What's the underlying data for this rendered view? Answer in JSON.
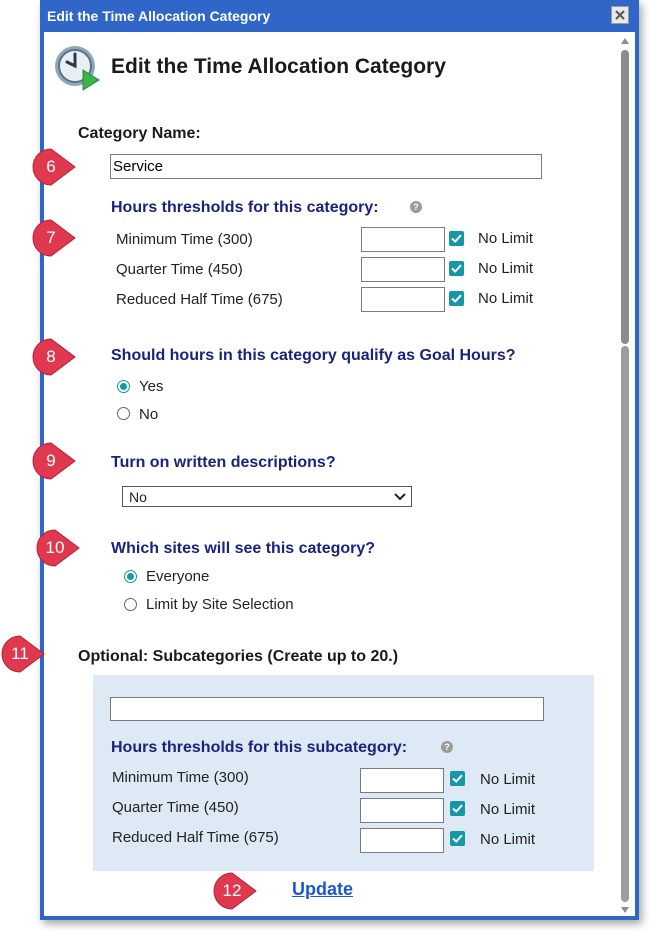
{
  "dialog": {
    "title": "Edit the Time Allocation Category",
    "close_symbol": "✕"
  },
  "header": {
    "icon": "clock-play-icon",
    "heading": "Edit the Time Allocation Category"
  },
  "category_name": {
    "label": "Category Name:",
    "value": "Service"
  },
  "thresholds": {
    "label": "Hours thresholds for this category:",
    "help_symbol": "?",
    "rows": [
      {
        "label": "Minimum Time (300)",
        "value": "",
        "no_limit": true,
        "no_limit_label": "No Limit"
      },
      {
        "label": "Quarter Time (450)",
        "value": "",
        "no_limit": true,
        "no_limit_label": "No Limit"
      },
      {
        "label": "Reduced Half Time (675)",
        "value": "",
        "no_limit": true,
        "no_limit_label": "No Limit"
      }
    ]
  },
  "goal_hours": {
    "question": "Should hours in this category qualify as Goal Hours?",
    "options": [
      {
        "label": "Yes",
        "selected": true
      },
      {
        "label": "No",
        "selected": false
      }
    ]
  },
  "descriptions": {
    "question": "Turn on written descriptions?",
    "selected": "No"
  },
  "sites": {
    "question": "Which sites will see this category?",
    "options": [
      {
        "label": "Everyone",
        "selected": true
      },
      {
        "label": "Limit by Site Selection",
        "selected": false
      }
    ]
  },
  "subcategories": {
    "label": "Optional: Subcategories (Create up to 20.)",
    "name_value": "",
    "thresholds_label": "Hours thresholds for this subcategory:",
    "help_symbol": "?",
    "rows": [
      {
        "label": "Minimum Time (300)",
        "value": "",
        "no_limit": true,
        "no_limit_label": "No Limit"
      },
      {
        "label": "Quarter Time (450)",
        "value": "",
        "no_limit": true,
        "no_limit_label": "No Limit"
      },
      {
        "label": "Reduced Half Time (675)",
        "value": "",
        "no_limit": true,
        "no_limit_label": "No Limit"
      }
    ]
  },
  "update_label": "Update",
  "callouts": [
    "6",
    "7",
    "8",
    "9",
    "10",
    "11",
    "12"
  ],
  "colors": {
    "frame": "#2f66c8",
    "accent": "#1597a5",
    "callout": "#e0394f",
    "navy": "#1a237e",
    "link": "#1a57d6",
    "panel": "#dde9f5"
  }
}
